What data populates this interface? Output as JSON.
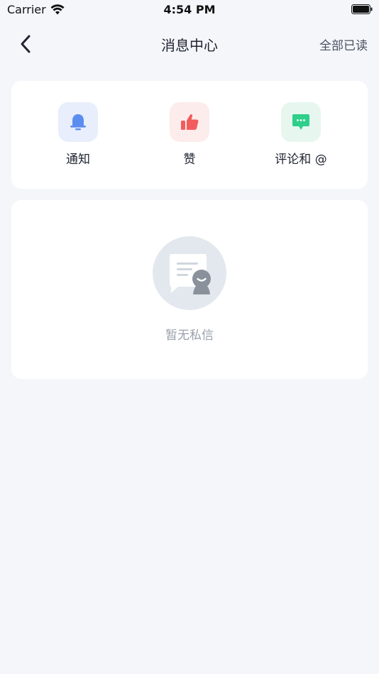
{
  "status_bar": {
    "carrier": "Carrier",
    "time": "4:54 PM"
  },
  "nav": {
    "title": "消息中心",
    "mark_all_read": "全部已读",
    "back_icon": "chevron-left-icon"
  },
  "categories": [
    {
      "label": "通知",
      "icon": "bell-icon",
      "color": "#5b8def",
      "bg": "#e8eefb"
    },
    {
      "label": "赞",
      "icon": "thumbs-up-icon",
      "color": "#f25c5c",
      "bg": "#fdecec"
    },
    {
      "label": "评论和 @",
      "icon": "comment-icon",
      "color": "#2ecf8a",
      "bg": "#e7f7ef"
    }
  ],
  "empty_state": {
    "text": "暂无私信",
    "icon": "empty-messages-icon"
  }
}
